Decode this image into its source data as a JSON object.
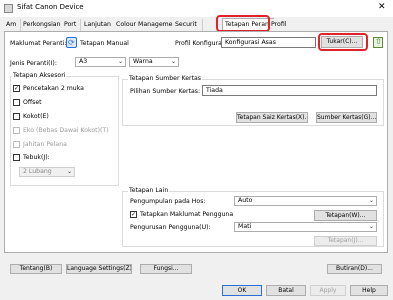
{
  "window": {
    "title": "Sifat Canon Device"
  },
  "tabs": [
    "Am",
    "Perkongsian",
    "Port",
    "Lanjutan",
    "Colour Management",
    "Securit",
    "Tetapan Peranti",
    "Profil"
  ],
  "top": {
    "device_info_label": "Maklumat Peranti:",
    "device_info_value": "Tetapan Manual",
    "profile_label": "Profil Konfigurasi:",
    "profile_value": "Konfigurasi Asas",
    "change_button": "Tukar(C)..."
  },
  "paper_type": {
    "label": "Jenis Peranti(I):",
    "value": "A3",
    "color_value": "Warna"
  },
  "accessories": {
    "title": "Tetapan Aksesori",
    "items": [
      {
        "label": "Pencetakan 2 muka",
        "checked": true,
        "disabled": false
      },
      {
        "label": "Offset",
        "checked": false,
        "disabled": false
      },
      {
        "label": "Kokot(E)",
        "checked": false,
        "disabled": false
      },
      {
        "label": "Eko (Bebas Dawai Kokot)(T)",
        "checked": false,
        "disabled": true
      },
      {
        "label": "Jahitan Pelana",
        "checked": false,
        "disabled": true
      },
      {
        "label": "Tebuk(J):",
        "checked": false,
        "disabled": false
      }
    ],
    "punch_select": "2 Lubang"
  },
  "paper_source": {
    "title": "Tetapan Sumber Kertas",
    "label": "Pilihan Sumber Kertas:",
    "value": "Tiada",
    "btn_size": "Tetapan Saiz Kertas(X)...",
    "btn_source": "Sumber Kertas(G)..."
  },
  "other": {
    "title": "Tetapan Lain",
    "hold_label": "Pengumpulan pada Hos:",
    "hold_value": "Auto",
    "user_info_label": "Tetapkan Maklumat Pengguna",
    "user_info_checked": true,
    "settings_button": "Tetapan(W)...",
    "user_mgmt_label": "Pengurusan Pengguna(U):",
    "user_mgmt_value": "Mati",
    "settings_button_2": "Tetapan(J)..."
  },
  "footer": {
    "about": "Tentang(B)",
    "language": "Language Settings(Z)...",
    "functions": "Fungsi...",
    "restore": "Butiran(D)..."
  },
  "dialog_buttons": {
    "ok": "OK",
    "cancel": "Batal",
    "apply": "Apply",
    "help": "Help"
  },
  "colors": {
    "highlight": "#e0232a",
    "accent": "#2a6fd6"
  }
}
